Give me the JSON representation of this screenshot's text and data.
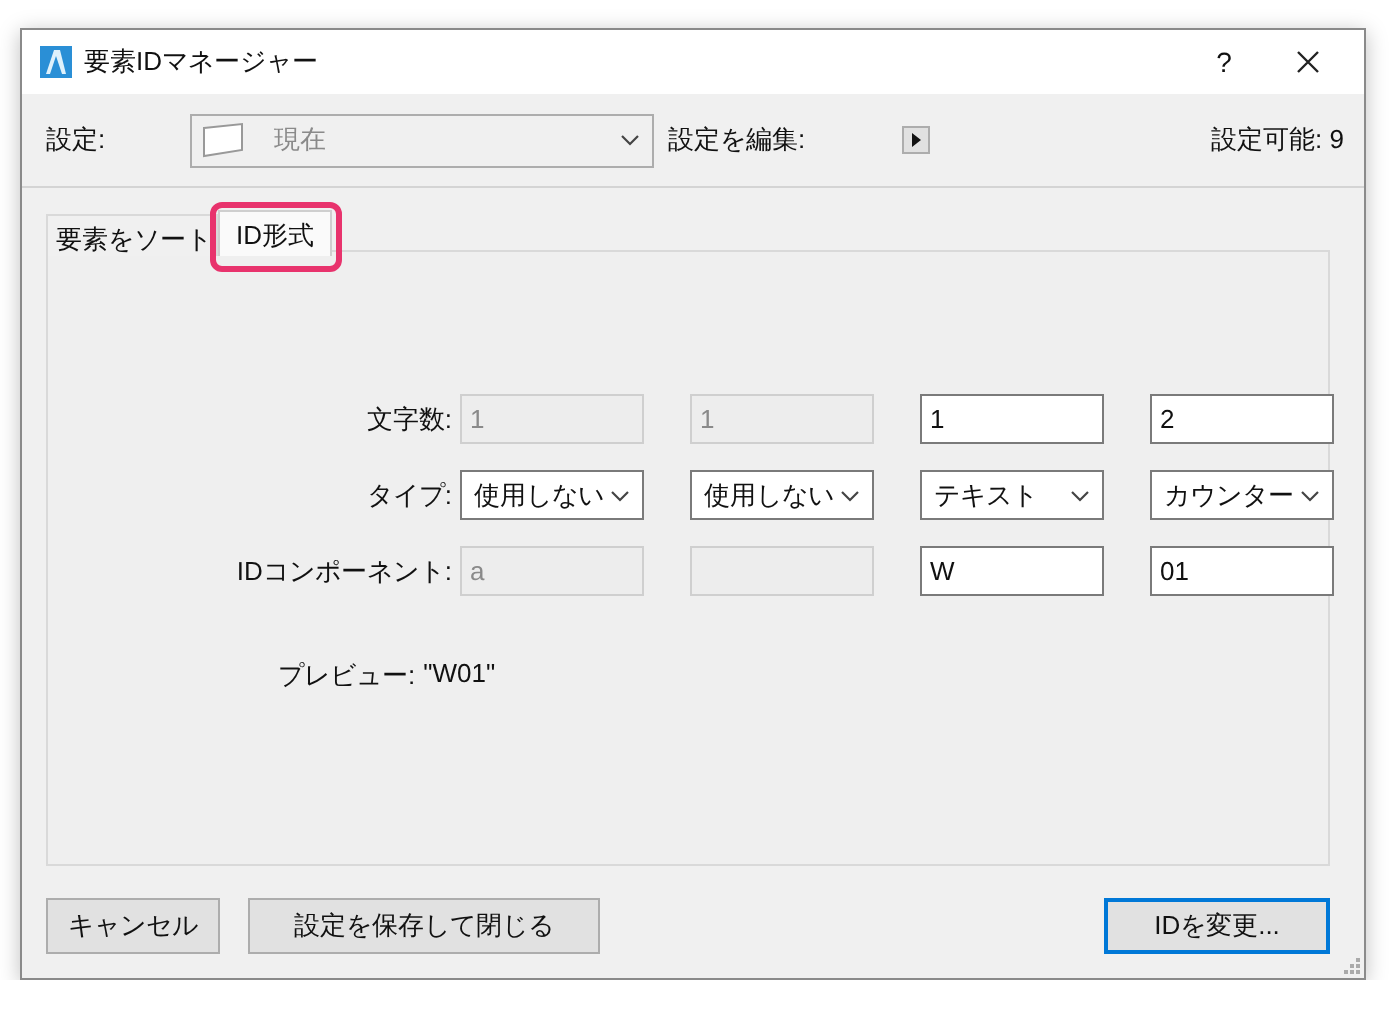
{
  "window": {
    "title": "要素IDマネージャー",
    "help": "?"
  },
  "toolbar": {
    "settings_label": "設定:",
    "settings_value": "現在",
    "edit_label": "設定を編集:",
    "available": "設定可能: 9"
  },
  "tabs": [
    {
      "label": "要素をソート",
      "selected": false,
      "highlighted": false
    },
    {
      "label": "ID形式",
      "selected": true,
      "highlighted": true
    }
  ],
  "rows": [
    {
      "label": "文字数:",
      "kind": "field",
      "cells": [
        {
          "value": "1",
          "disabled": true
        },
        {
          "value": "1",
          "disabled": true
        },
        {
          "value": "1",
          "disabled": false
        },
        {
          "value": "2",
          "disabled": false
        }
      ]
    },
    {
      "label": "タイプ:",
      "kind": "select",
      "cells": [
        {
          "value": "使用しない",
          "disabled": false
        },
        {
          "value": "使用しない",
          "disabled": false
        },
        {
          "value": "テキスト",
          "disabled": false
        },
        {
          "value": "カウンター",
          "disabled": false
        }
      ]
    },
    {
      "label": "IDコンポーネント:",
      "kind": "field",
      "cells": [
        {
          "value": "a",
          "disabled": true
        },
        {
          "disabled": true
        },
        {
          "value": "W",
          "disabled": false
        },
        {
          "value": "01",
          "disabled": false
        }
      ]
    }
  ],
  "preview": {
    "label": "プレビュー:",
    "value": "\"W01\""
  },
  "buttons": [
    {
      "label": "キャンセル",
      "default": false
    },
    {
      "label": "設定を保存して閉じる",
      "default": false
    },
    {
      "label": "IDを変更...",
      "default": true
    }
  ]
}
